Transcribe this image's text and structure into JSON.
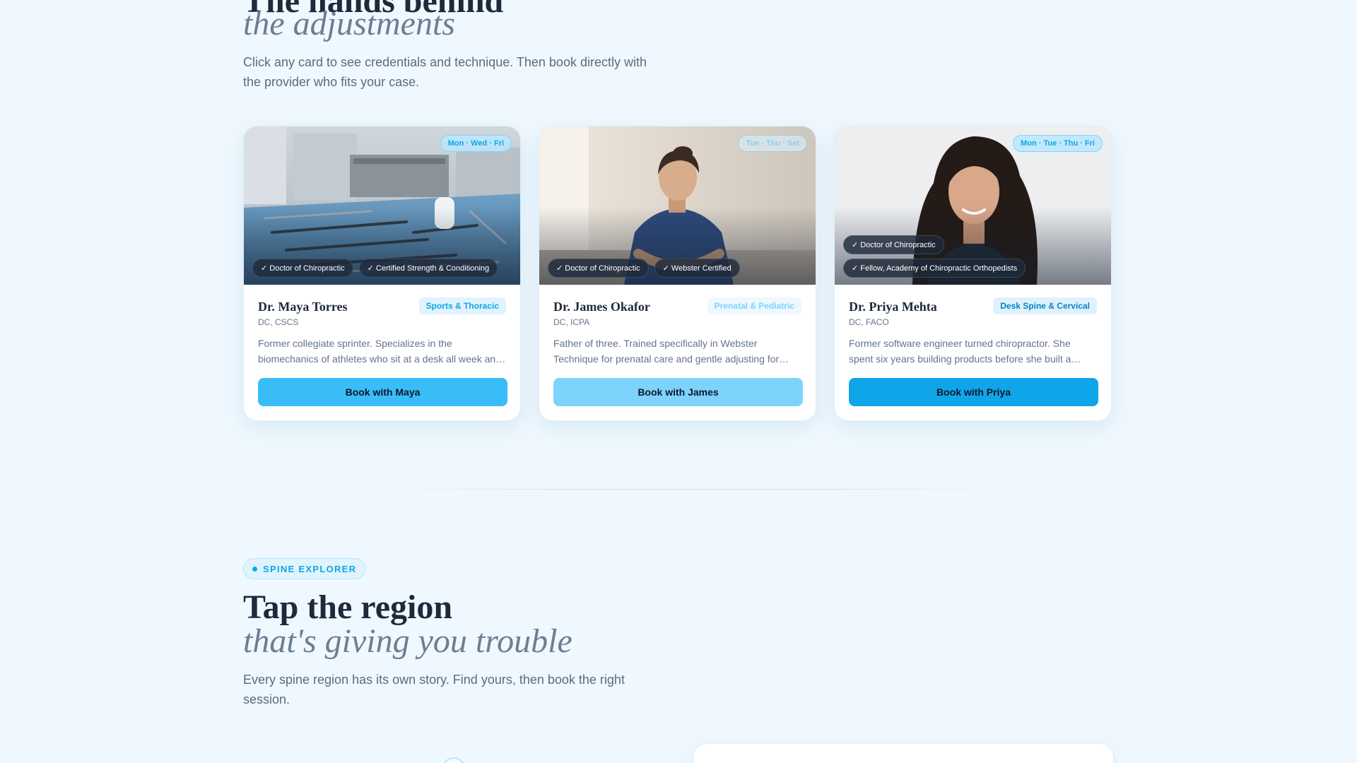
{
  "section_team": {
    "title": "The hands behind",
    "title_italic": "the adjustments",
    "subtitle": "Click any card to see credentials and technique. Then book directly with the provider who fits your case."
  },
  "cards": [
    {
      "name": "Dr. Maya Torres",
      "credentials": "DC, CSCS",
      "specialty": "Sports & Thoracic",
      "days": "Mon · Wed · Fri",
      "badges": [
        "✓ Doctor of Chiropractic",
        "✓ Certified Strength & Conditioning"
      ],
      "bio": "Former collegiate sprinter. Specializes in the biomechanics of athletes who sit at a desk all week and train hard on weekends.",
      "button": "Book with Maya",
      "photo": "surgical-instruments-tray"
    },
    {
      "name": "Dr. James Okafor",
      "credentials": "DC, ICPA",
      "specialty": "Prenatal & Pediatric",
      "days": "Tue · Thu · Sat",
      "badges": [
        "✓ Doctor of Chiropractic",
        "✓ Webster Certified"
      ],
      "bio": "Father of three. Trained specifically in Webster Technique for prenatal care and gentle adjusting for infants and kids.",
      "button": "Book with James",
      "photo": "practitioner-at-work"
    },
    {
      "name": "Dr. Priya Mehta",
      "credentials": "DC, FACO",
      "specialty": "Desk Spine & Cervical",
      "days": "Mon · Tue · Thu · Fri",
      "badges": [
        "✓ Doctor of Chiropractic",
        "✓ Fellow, Academy of Chiropractic Orthopedists"
      ],
      "bio": "Former software engineer turned chiropractor. She spent six years building products before she built a practice around the people who build them.",
      "button": "Book with Priya",
      "photo": "smiling-portrait"
    }
  ],
  "section_spine": {
    "pill": "SPINE EXPLORER",
    "title": "Tap the region",
    "title_italic": "that's giving you trouble",
    "subtitle": "Every spine region has its own story. Find yours, then book the right session."
  },
  "colors": {
    "page_bg": "#eff8fe",
    "accent": "#0ea5e9",
    "accent_light": "#7dd3fc",
    "text_dark": "#1e293b",
    "text_muted": "#64748b"
  }
}
